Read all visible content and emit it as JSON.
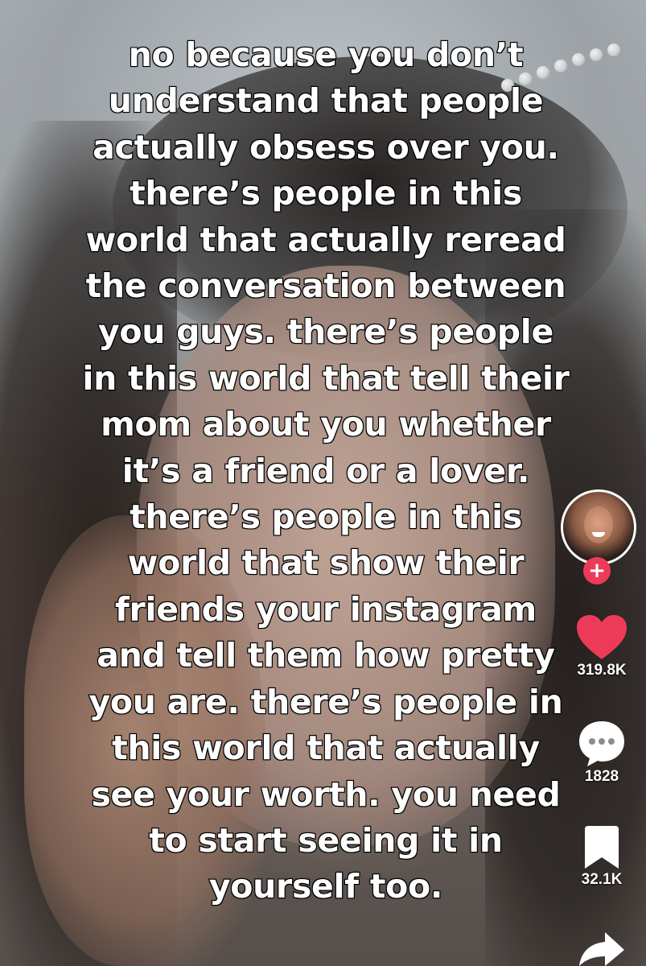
{
  "caption": {
    "lines": [
      "no because you don’t",
      "understand that people",
      "actually obsess over you.",
      "there’s people in this",
      "world that actually reread",
      "the conversation between",
      "you guys. there’s people",
      "in this world that tell their",
      "mom about you whether",
      "it’s a friend or a lover.",
      "there’s people in this",
      "world that show their",
      "friends your instagram",
      "and tell them how pretty",
      "you are. there’s people in",
      "this world that actually",
      "see your worth. you need",
      "to start seeing it in",
      "yourself too."
    ]
  },
  "sidebar": {
    "follow_symbol": "+",
    "likes": "319.8K",
    "comments": "1828",
    "saves": "32.1K",
    "icons": {
      "avatar": "creator-avatar",
      "follow": "plus-icon",
      "like": "heart-icon",
      "comment": "comment-bubble-icon",
      "save": "bookmark-icon",
      "share": "share-arrow-icon"
    },
    "colors": {
      "like": "#ec3b58",
      "follow_badge": "#ec3b58",
      "icon_default": "#ffffff"
    }
  }
}
